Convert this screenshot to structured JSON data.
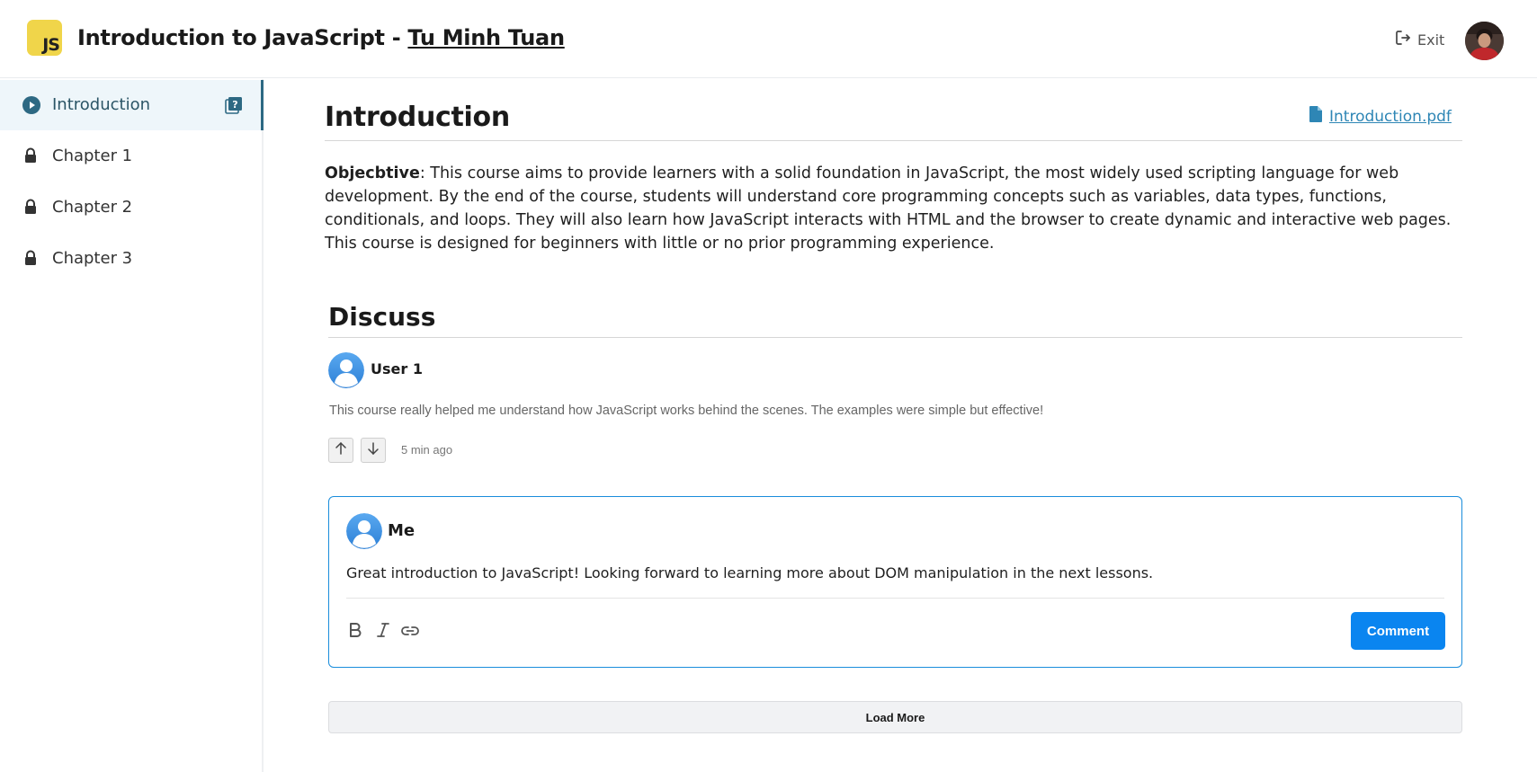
{
  "header": {
    "logo_text": "JS",
    "title_prefix": "Introduction to JavaScript - ",
    "author": "Tu Minh Tuan",
    "exit_label": "Exit"
  },
  "sidebar": {
    "items": [
      {
        "label": "Introduction",
        "state": "active",
        "icon": "play-circle-icon"
      },
      {
        "label": "Chapter 1",
        "state": "locked",
        "icon": "lock-icon"
      },
      {
        "label": "Chapter 2",
        "state": "locked",
        "icon": "lock-icon"
      },
      {
        "label": "Chapter 3",
        "state": "locked",
        "icon": "lock-icon"
      }
    ]
  },
  "main": {
    "title": "Introduction",
    "attachment": "Introduction.pdf",
    "objective_label": "Objecbtive",
    "objective_text": ": This course aims to provide learners with a solid foundation in JavaScript, the most widely used scripting language for web development. By the end of the course, students will understand core programming concepts such as variables, data types, functions, conditionals, and loops. They will also learn how JavaScript interacts with HTML and the browser to create dynamic and interactive web pages. This course is designed for beginners with little or no prior programming experience."
  },
  "discuss": {
    "title": "Discuss",
    "comments": [
      {
        "user": "User 1",
        "text": "This course really helped me understand how JavaScript works behind the scenes. The examples were simple but effective!",
        "time": "5 min ago"
      }
    ],
    "editor": {
      "user": "Me",
      "text": "Great introduction to JavaScript! Looking forward to learning more about DOM manipulation in the next lessons.",
      "submit_label": "Comment"
    },
    "load_more_label": "Load More"
  },
  "colors": {
    "accent": "#0a85f0",
    "active_sidebar": "#2d6983",
    "link": "#2e86b5",
    "logo_bg": "#f0d54a"
  }
}
